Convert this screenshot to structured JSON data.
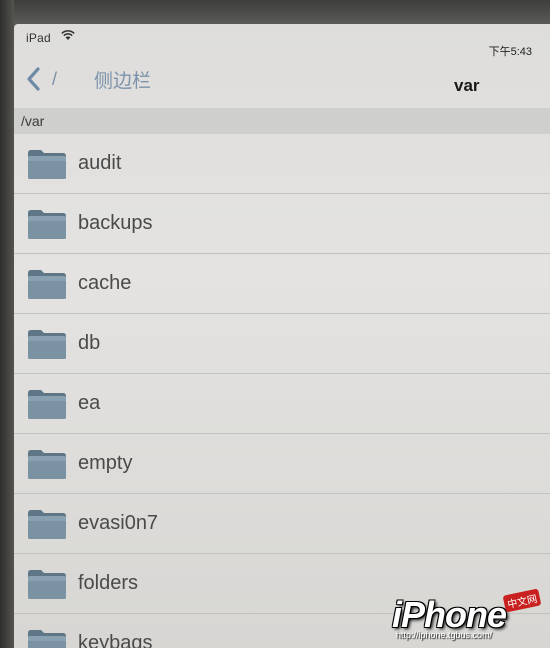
{
  "status_bar": {
    "device": "iPad",
    "wifi_icon": "wifi-icon",
    "time": "下午5:43"
  },
  "nav": {
    "back_slash": "/",
    "back_title": "侧边栏",
    "title": "var",
    "back_icon": "chevron-left-icon"
  },
  "path": "/var",
  "files": [
    {
      "name": "audit"
    },
    {
      "name": "backups"
    },
    {
      "name": "cache"
    },
    {
      "name": "db"
    },
    {
      "name": "ea"
    },
    {
      "name": "empty"
    },
    {
      "name": "evasi0n7"
    },
    {
      "name": "folders"
    },
    {
      "name": "keybags"
    }
  ],
  "watermark": {
    "logo": "iPhone",
    "badge": "中文网",
    "url": "http://iphone.tgbus.com/"
  },
  "colors": {
    "accent": "#7d93ab",
    "folder": "#6f8798",
    "screen_bg": "#e2e1df"
  }
}
